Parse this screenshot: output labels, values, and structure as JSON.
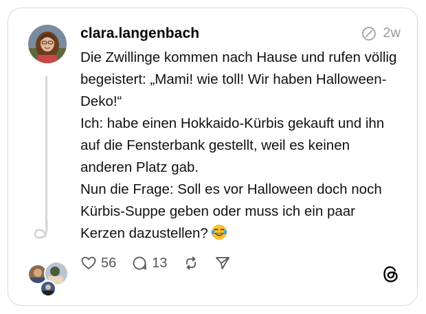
{
  "post": {
    "username": "clara.langenbach",
    "time": "2w",
    "text": "Die Zwillinge kommen nach Hause und rufen völlig begeistert: „Mami! wie toll! Wir haben Halloween-Deko!“\nIch: habe einen Hokkaido-Kürbis gekauft und ihn auf die Fensterbank gestellt, weil es keinen anderen Platz gab.\nNun die Frage: Soll es vor Halloween doch noch Kürbis-Suppe geben oder muss ich ein paar Kerzen dazustellen?",
    "emoji": "laughing-tears-emoji"
  },
  "actions": {
    "likes": "56",
    "replies": "13"
  },
  "icons": {
    "meta": "unverified-circle-icon",
    "like": "heart-icon",
    "reply": "comment-icon",
    "repost": "repost-icon",
    "share": "send-icon",
    "brand": "threads-logo"
  },
  "colors": {
    "border": "#d9d9d9",
    "muted": "#9a9a9a",
    "thread_line": "#d6d6d6"
  }
}
